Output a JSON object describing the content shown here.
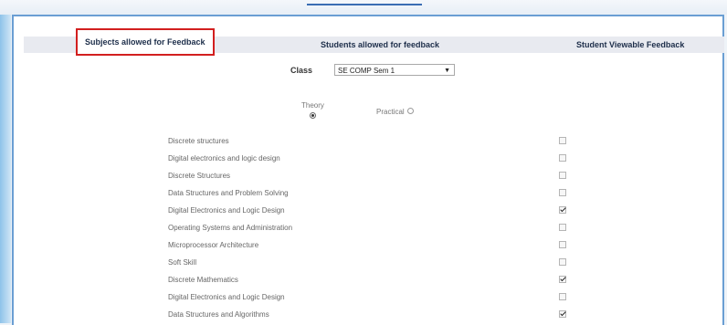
{
  "tabs": {
    "subjects_label": "Subjects allowed for Feedback",
    "students_label": "Students allowed for feedback",
    "viewable_label": "Student Viewable Feedback"
  },
  "class_selector": {
    "label": "Class",
    "selected": "SE COMP Sem 1"
  },
  "type_options": {
    "theory_label": "Theory",
    "practical_label": "Practical",
    "selected": "Theory"
  },
  "subjects": [
    {
      "name": "Discrete structures",
      "checked": false
    },
    {
      "name": "Digital electronics and logic design",
      "checked": false
    },
    {
      "name": "Discrete Structures",
      "checked": false
    },
    {
      "name": "Data Structures and Problem Solving",
      "checked": false
    },
    {
      "name": "Digital Electronics and Logic Design",
      "checked": true
    },
    {
      "name": "Operating Systems and Administration",
      "checked": false
    },
    {
      "name": "Microprocessor Architecture",
      "checked": false
    },
    {
      "name": "Soft Skill",
      "checked": false
    },
    {
      "name": "Discrete Mathematics",
      "checked": true
    },
    {
      "name": "Digital Electronics and Logic Design",
      "checked": false
    },
    {
      "name": "Data Structures and Algorithms",
      "checked": true
    }
  ],
  "colors": {
    "frame_border": "#6a9ed3",
    "active_tab_border": "#d21f1f",
    "tabbar_bg": "#e8eaf0"
  }
}
